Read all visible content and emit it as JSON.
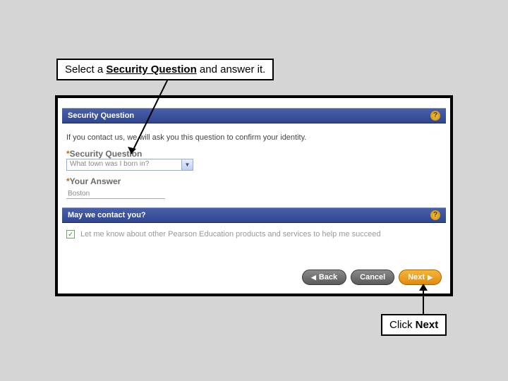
{
  "callouts": {
    "top_prefix": "Select a ",
    "top_bold": "Security Question",
    "top_suffix": " and answer it.",
    "bottom_prefix": "Click ",
    "bottom_bold": "Next"
  },
  "panels": {
    "security": {
      "title": "Security Question",
      "instruction": "If you contact us, we will ask you this question to confirm your identity.",
      "question_label": "Security Question",
      "question_value": "What town was I born in?",
      "answer_label": "Your Answer",
      "answer_value": "Boston"
    },
    "contact": {
      "title": "May we contact you?",
      "optin_text": "Let me know about other Pearson Education products and services to help me succeed"
    }
  },
  "buttons": {
    "back": "Back",
    "cancel": "Cancel",
    "next": "Next"
  },
  "required_mark": "*"
}
